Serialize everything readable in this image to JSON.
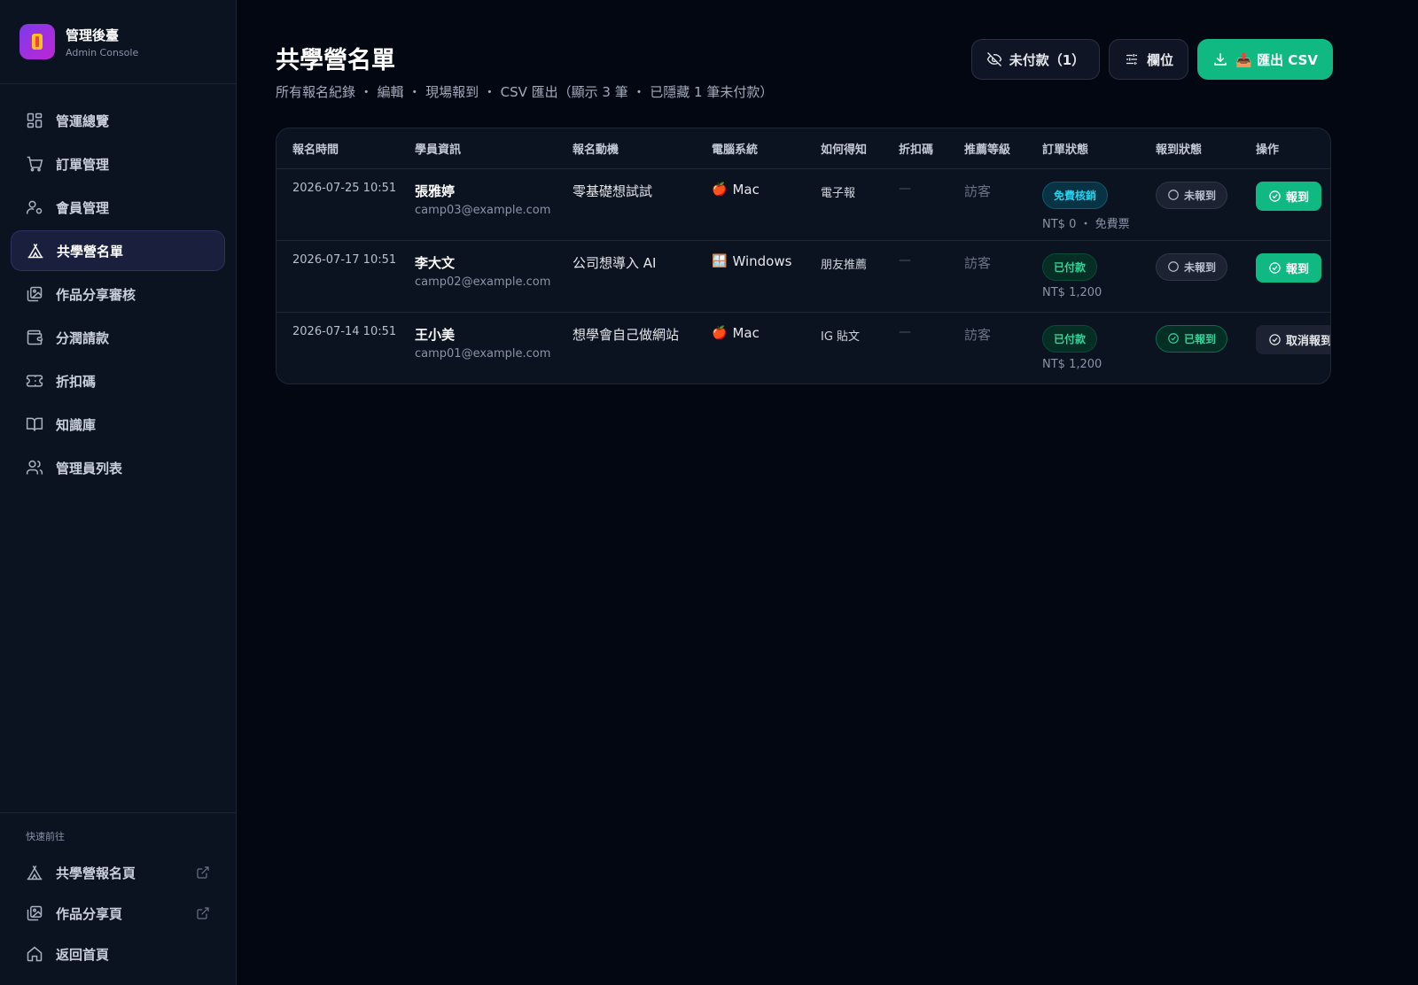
{
  "brand": {
    "title": "管理後臺",
    "subtitle": "Admin Console"
  },
  "nav": [
    {
      "label": "管運總覽",
      "icon": "dashboard-icon"
    },
    {
      "label": "訂單管理",
      "icon": "cart-icon"
    },
    {
      "label": "會員管理",
      "icon": "user-gear-icon"
    },
    {
      "label": "共學營名單",
      "icon": "tent-icon",
      "active": true
    },
    {
      "label": "作品分享審核",
      "icon": "gallery-icon"
    },
    {
      "label": "分潤請款",
      "icon": "wallet-icon"
    },
    {
      "label": "折扣碼",
      "icon": "ticket-icon"
    },
    {
      "label": "知識庫",
      "icon": "book-icon"
    },
    {
      "label": "管理員列表",
      "icon": "users-icon"
    }
  ],
  "quick": {
    "title": "快速前往",
    "items": [
      {
        "label": "共學營報名頁",
        "icon": "tent-icon",
        "external": true
      },
      {
        "label": "作品分享頁",
        "icon": "gallery-icon",
        "external": true
      },
      {
        "label": "返回首頁",
        "icon": "home-icon",
        "external": false
      }
    ]
  },
  "header": {
    "title": "共學營名單",
    "subtitle": "所有報名紀錄 ・ 編輯 ・ 現場報到 ・ CSV 匯出（顯示 3 筆 ・ 已隱藏 1 筆未付款）",
    "unpaid_button": "未付款（1）",
    "columns_button": "欄位",
    "export_button": "📥 匯出 CSV"
  },
  "table": {
    "columns": [
      "報名時間",
      "學員資訊",
      "報名動機",
      "電腦系統",
      "如何得知",
      "折扣碼",
      "推薦等級",
      "訂單狀態",
      "報到狀態",
      "操作"
    ],
    "rows": [
      {
        "time": "2026-07-25 10:51",
        "name": "張雅婷",
        "email": "camp03@example.com",
        "motive": "零基礎想試試",
        "os_icon": "🍎",
        "os": "Mac",
        "source": "電子報",
        "coupon": "—",
        "grade": "訪客",
        "status": "免費核銷",
        "status_type": "free",
        "price": "NT$ 0 ・ 免費票",
        "checkin": "未報到",
        "checked_in": false,
        "action": "報到"
      },
      {
        "time": "2026-07-17 10:51",
        "name": "李大文",
        "email": "camp02@example.com",
        "motive": "公司想導入 AI",
        "os_icon": "🪟",
        "os": "Windows",
        "source": "朋友推薦",
        "coupon": "—",
        "grade": "訪客",
        "status": "已付款",
        "status_type": "paid",
        "price": "NT$ 1,200",
        "checkin": "未報到",
        "checked_in": false,
        "action": "報到"
      },
      {
        "time": "2026-07-14 10:51",
        "name": "王小美",
        "email": "camp01@example.com",
        "motive": "想學會自己做網站",
        "os_icon": "🍎",
        "os": "Mac",
        "source": "IG 貼文",
        "coupon": "—",
        "grade": "訪客",
        "status": "已付款",
        "status_type": "paid",
        "price": "NT$ 1,200",
        "checkin": "已報到",
        "checked_in": true,
        "action": "取消報到"
      }
    ]
  },
  "colors": {
    "accent": "#10b981",
    "active_nav": "#1a1f3d",
    "background": "#030712",
    "sidebar": "#0b1220"
  }
}
